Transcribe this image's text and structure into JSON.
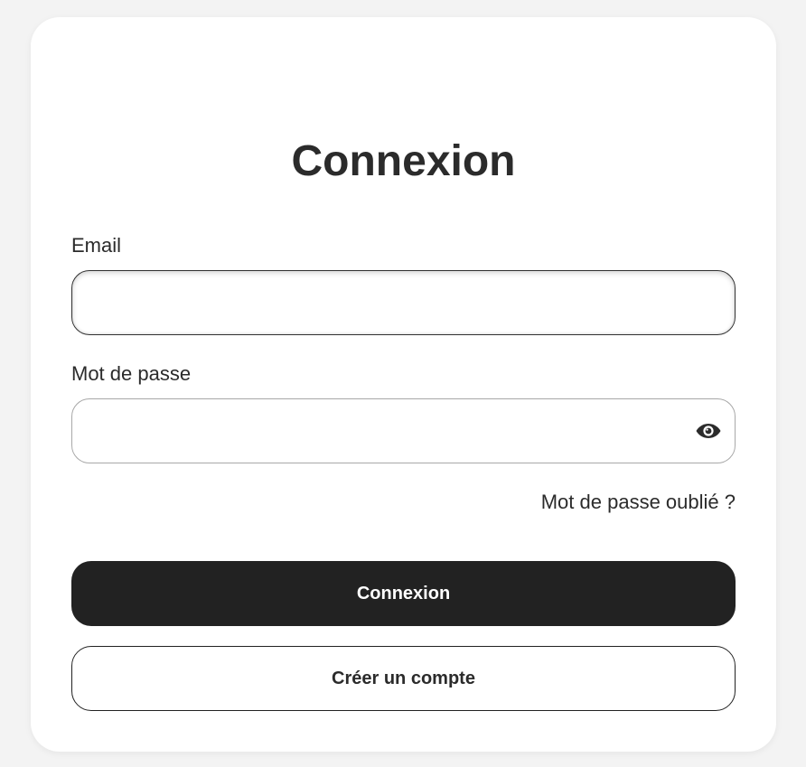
{
  "login": {
    "title": "Connexion",
    "email_label": "Email",
    "email_value": "",
    "email_placeholder": "",
    "password_label": "Mot de passe",
    "password_value": "",
    "password_placeholder": "",
    "password_toggle_icon": "eye-icon",
    "forgot_link": "Mot de passe oublié ?",
    "submit_label": "Connexion",
    "create_account_label": "Créer un compte"
  },
  "colors": {
    "background": "#f3f3f3",
    "card": "#ffffff",
    "text": "#2b2b2b",
    "primary_button": "#222222",
    "primary_button_text": "#ffffff"
  }
}
